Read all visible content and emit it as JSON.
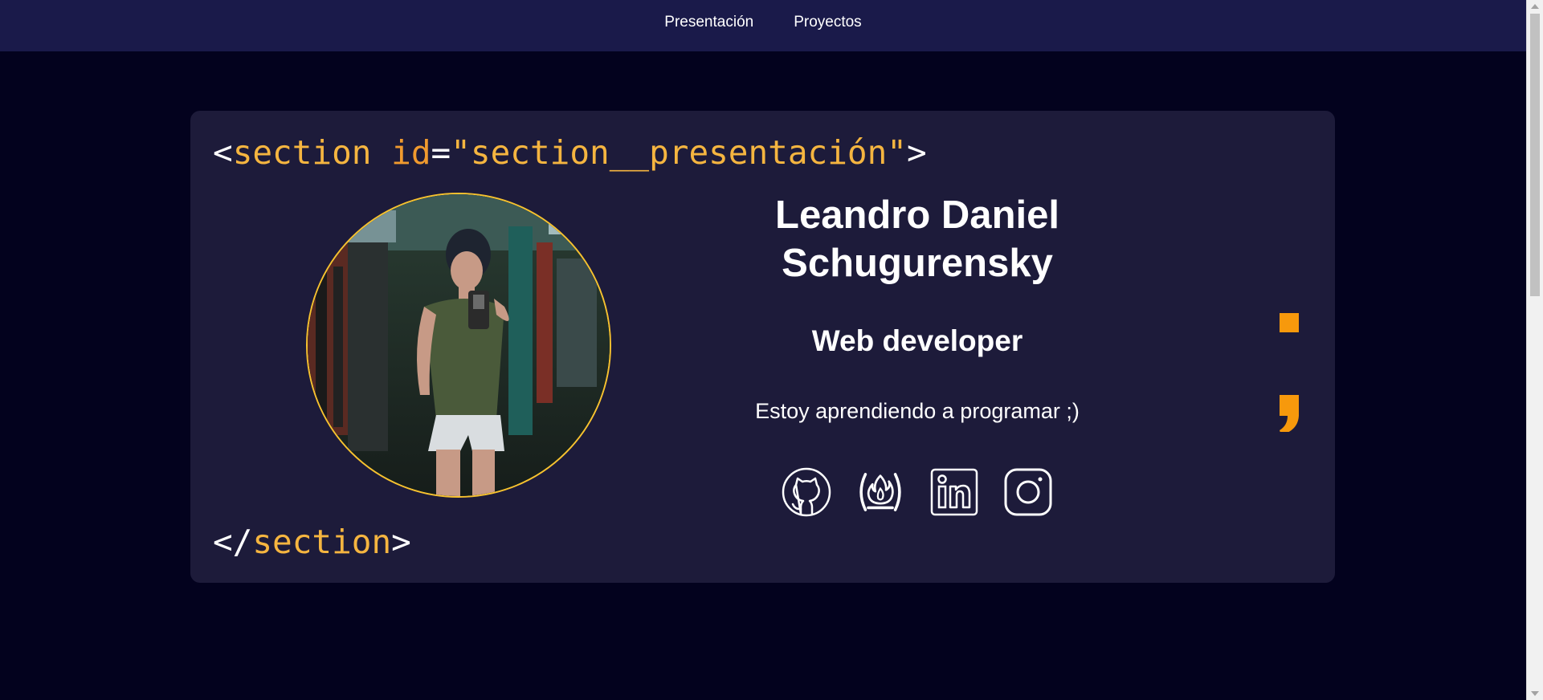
{
  "nav": {
    "items": [
      {
        "label": "Presentación"
      },
      {
        "label": "Proyectos"
      }
    ]
  },
  "code": {
    "open_bracket": "<",
    "tag": "section",
    "attr": "id",
    "equals": "=",
    "value": "\"section__presentación\"",
    "close_bracket": ">",
    "close_open": "</",
    "close_tag": "section",
    "close_end": ">"
  },
  "profile": {
    "name": "Leandro Daniel Schugurensky",
    "role": "Web developer",
    "description": "Estoy aprendiendo a programar ;)"
  },
  "social": [
    {
      "icon": "github-icon"
    },
    {
      "icon": "freecodecamp-icon"
    },
    {
      "icon": "linkedin-icon"
    },
    {
      "icon": "instagram-icon"
    }
  ],
  "colors": {
    "background": "#03021e",
    "navbar": "#1a1a4a",
    "card": "#1d1b3a",
    "accent": "#f5b540",
    "semicolon": "#f7990c",
    "avatar_border": "#f7c22f"
  }
}
